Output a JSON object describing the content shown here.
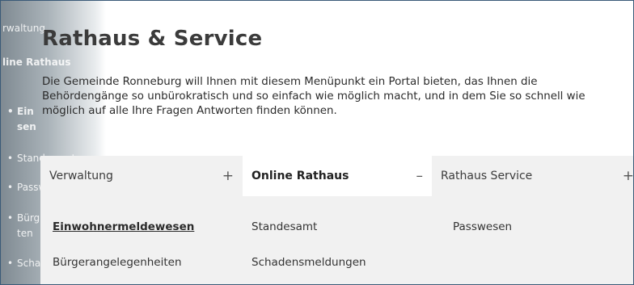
{
  "sidebar": {
    "items": [
      {
        "label": "rwaltung",
        "style": "plain"
      },
      {
        "label": "line Rathaus",
        "style": "bold"
      },
      {
        "label": "Ein",
        "style": "bold-bullet"
      },
      {
        "label": "sen",
        "style": "bold"
      },
      {
        "label": "Standesamt",
        "style": "bullet"
      },
      {
        "label": "Passwesen",
        "style": "bullet"
      },
      {
        "label": "Bürg",
        "style": "bullet"
      },
      {
        "label": "ten",
        "style": "plain"
      },
      {
        "label": "Scha",
        "style": "bullet"
      }
    ]
  },
  "page": {
    "title": "Rathaus & Service",
    "intro": "Die Gemeinde Ronneburg will Ihnen mit diesem Menüpunkt ein Portal bieten, das Ihnen die Behördengänge so unbürokratisch und so einfach wie möglich macht, und in dem Sie so schnell wie möglich auf alle Ihre Fragen Antworten finden können."
  },
  "tabs": [
    {
      "label": "Verwaltung",
      "sign": "+"
    },
    {
      "label": "Online Rathaus",
      "sign": "–"
    },
    {
      "label": "Rathaus Service",
      "sign": "+"
    }
  ],
  "panel": {
    "links": [
      {
        "label": "Einwohnermeldewesen"
      },
      {
        "label": "Standesamt"
      },
      {
        "label": "Passwesen"
      },
      {
        "label": "Bürgerangelegenheiten"
      },
      {
        "label": "Schadensmeldungen"
      }
    ]
  },
  "colors": {
    "frame_border": "#3a5a78",
    "tab_bg": "#f1f1f1",
    "active_tab_bg": "#ffffff",
    "text": "#3b3b3b"
  }
}
